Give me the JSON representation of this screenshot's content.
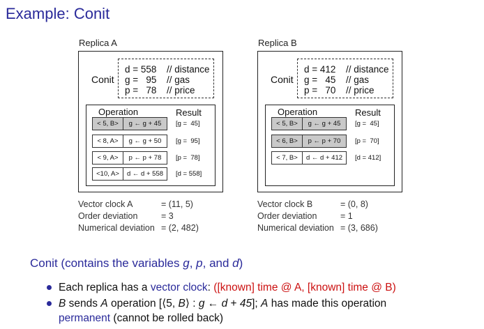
{
  "title": "Example: Conit",
  "replicas": [
    {
      "label": "Replica A",
      "conit_label": "Conit",
      "vars": [
        {
          "name": "d",
          "value": "558",
          "comment": "// distance"
        },
        {
          "name": "g",
          "value": "95",
          "comment": "// gas"
        },
        {
          "name": "p",
          "value": "78",
          "comment": "// price"
        }
      ],
      "operation_header": "Operation",
      "result_header": "Result",
      "operations": [
        {
          "timestamp": "< 5, B>",
          "expr": "g ← g + 45",
          "result": "[g =  45]",
          "shaded": true
        },
        {
          "timestamp": "< 8, A>",
          "expr": "g ← g + 50",
          "result": "[g =  95]",
          "shaded": false
        },
        {
          "timestamp": "< 9, A>",
          "expr": "p ← p + 78",
          "result": "[p =  78]",
          "shaded": false
        },
        {
          "timestamp": "<10, A>",
          "expr": "d ← d + 558",
          "result": "[d = 558]",
          "shaded": false
        }
      ],
      "info": [
        {
          "key": "Vector clock A",
          "value": "= (11, 5)"
        },
        {
          "key": "Order deviation",
          "value": "= 3"
        },
        {
          "key": "Numerical deviation",
          "value": "= (2, 482)"
        }
      ]
    },
    {
      "label": "Replica B",
      "conit_label": "Conit",
      "vars": [
        {
          "name": "d",
          "value": "412",
          "comment": "// distance"
        },
        {
          "name": "g",
          "value": "45",
          "comment": "// gas"
        },
        {
          "name": "p",
          "value": "70",
          "comment": "// price"
        }
      ],
      "operation_header": "Operation",
      "result_header": "Result",
      "operations": [
        {
          "timestamp": "< 5, B>",
          "expr": "g ← g + 45",
          "result": "[g =  45]",
          "shaded": true
        },
        {
          "timestamp": "< 6, B>",
          "expr": "p ← p + 70",
          "result": "[p =  70]",
          "shaded": true
        },
        {
          "timestamp": "< 7, B>",
          "expr": "d ← d + 412",
          "result": "[d = 412]",
          "shaded": false
        }
      ],
      "info": [
        {
          "key": "Vector clock B",
          "value": "= (0, 8)"
        },
        {
          "key": "Order deviation",
          "value": "= 1"
        },
        {
          "key": "Numerical deviation",
          "value": "= (3, 686)"
        }
      ]
    }
  ],
  "subtitle": {
    "prefix": "Conit (contains the variables ",
    "v1": "g",
    "sep1": ", ",
    "v2": "p",
    "sep2": ", and ",
    "v3": "d",
    "suffix": ")"
  },
  "bullets": {
    "b1": {
      "text1": "Each replica has a ",
      "term": "vector clock",
      "text2": ": ",
      "red": "([known] time @ A, [known] time @ B)"
    },
    "b2": {
      "b": "B",
      "t1": " sends ",
      "a": "A",
      "t2": " operation [⟨5, ",
      "b_inner": "B",
      "t3": "⟩ : ",
      "g": "g",
      "t4": " ← ",
      "d": "d",
      "t5": " + ",
      "n": "45",
      "t6": "]; ",
      "a2": "A",
      "t7": " has made this operation",
      "term": "permanent",
      "t8": " (cannot be rolled back)"
    }
  },
  "colors": {
    "accent": "#2a2a9a",
    "highlight": "#cc1111",
    "shaded_row": "#c9c9c9"
  }
}
